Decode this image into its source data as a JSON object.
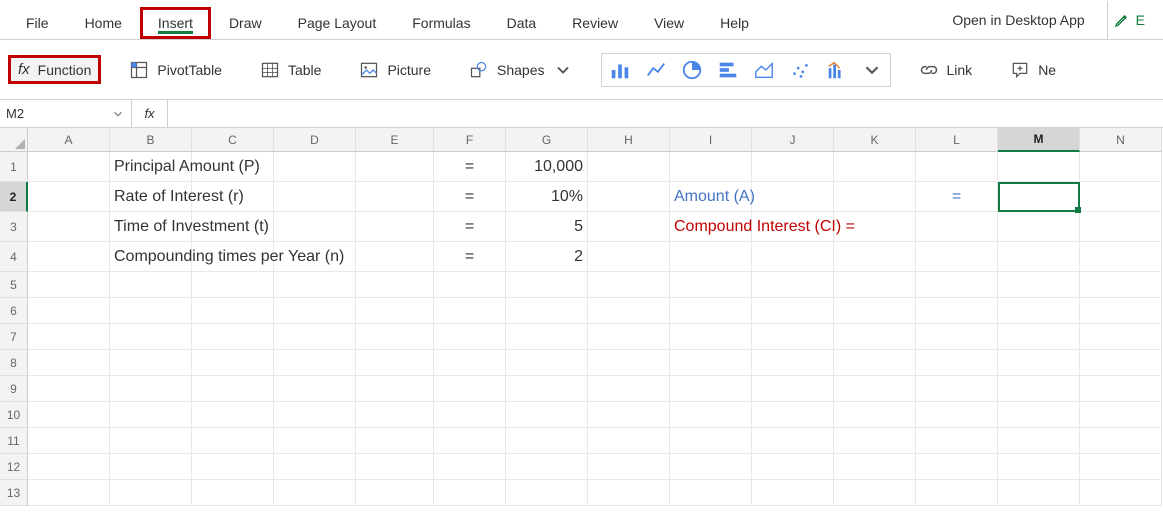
{
  "tabs": {
    "file": "File",
    "home": "Home",
    "insert": "Insert",
    "draw": "Draw",
    "pageLayout": "Page Layout",
    "formulas": "Formulas",
    "data": "Data",
    "review": "Review",
    "view": "View",
    "help": "Help",
    "openDesktop": "Open in Desktop App",
    "edit": "E"
  },
  "ribbon": {
    "function": "Function",
    "pivotTable": "PivotTable",
    "table": "Table",
    "picture": "Picture",
    "shapes": "Shapes",
    "link": "Link",
    "newComment": "Ne"
  },
  "formulaBar": {
    "nameBox": "M2",
    "fx": "fx",
    "formula": ""
  },
  "columns": [
    "A",
    "B",
    "C",
    "D",
    "E",
    "F",
    "G",
    "H",
    "I",
    "J",
    "K",
    "L",
    "M",
    "N"
  ],
  "colWidths": {
    "A": 82,
    "B": 82,
    "C": 82,
    "D": 82,
    "E": 78,
    "F": 72,
    "G": 82,
    "H": 82,
    "I": 82,
    "J": 82,
    "K": 82,
    "L": 82,
    "M": 82,
    "N": 82
  },
  "rowsVisible": 13,
  "tallRows": [
    1,
    2,
    3,
    4
  ],
  "selected": {
    "col": "M",
    "row": 2
  },
  "cells": {
    "r1": {
      "B": "Principal Amount (P)",
      "F": "=",
      "G": "10,000"
    },
    "r2": {
      "B": "Rate of Interest (r)",
      "F": "=",
      "G": "10%",
      "I": "Amount (A)",
      "L": "="
    },
    "r3": {
      "B": "Time of Investment (t)",
      "F": "=",
      "G": "5",
      "I": "Compound Interest (CI) ="
    },
    "r4": {
      "B": "Compounding times per Year (n)",
      "F": "=",
      "G": "2"
    }
  }
}
